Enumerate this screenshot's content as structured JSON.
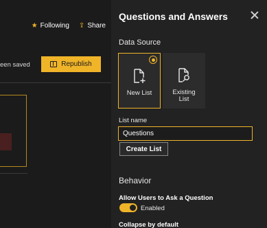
{
  "background": {
    "following_label": "Following",
    "share_label": "Share",
    "saved_text": "een saved",
    "republish_label": "Republish"
  },
  "panel": {
    "title": "Questions and Answers",
    "data_source_label": "Data Source",
    "options": [
      {
        "label": "New List",
        "selected": true
      },
      {
        "label": "Existing\nList",
        "selected": false
      }
    ],
    "list_name_label": "List name",
    "list_name_value": "Questions",
    "create_button_label": "Create List",
    "behavior_label": "Behavior",
    "allow_label": "Allow Users to Ask a Question",
    "toggle_state_label": "Enabled",
    "toggle_on": true,
    "collapse_label": "Collapse by default"
  },
  "colors": {
    "accent": "#f0b429",
    "panel_bg": "#222222",
    "page_bg": "#1b1b1b"
  }
}
